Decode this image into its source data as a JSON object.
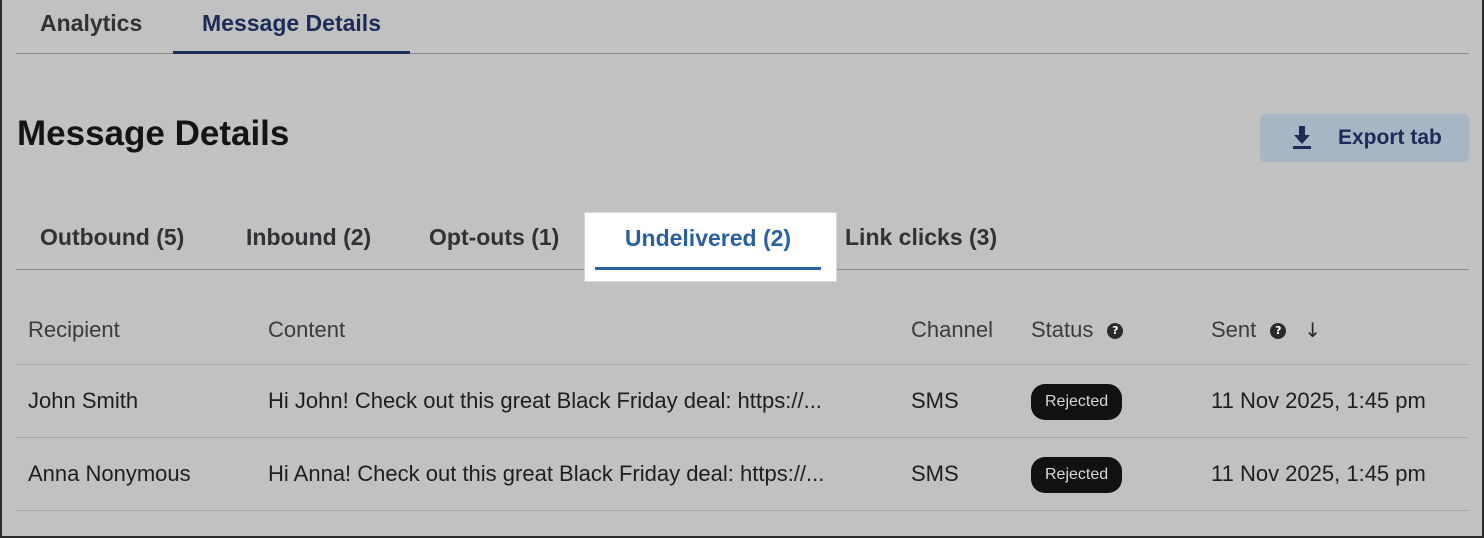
{
  "top_tabs": [
    "Analytics",
    "Message Details"
  ],
  "page_title": "Message Details",
  "export_button": {
    "label": "Export tab",
    "icon": "download-icon"
  },
  "sub_tabs": [
    "Outbound (5)",
    "Inbound (2)",
    "Opt-outs (1)",
    "Undelivered (2)",
    "Link clicks (3)"
  ],
  "active_sub_tab": "Undelivered (2)",
  "table": {
    "columns": [
      "Recipient",
      "Content",
      "Channel",
      "Status",
      "Sent"
    ],
    "help_glyph": "?",
    "sort_glyph": "↓",
    "rows": [
      {
        "recipient": "John Smith",
        "content": "Hi John! Check out this great Black Friday deal: https://...",
        "channel": "SMS",
        "status": "Rejected",
        "sent": "11 Nov 2025, 1:45 pm"
      },
      {
        "recipient": "Anna Nonymous",
        "content": "Hi Anna! Check out this great Black Friday deal: https://...",
        "channel": "SMS",
        "status": "Rejected",
        "sent": "11 Nov 2025, 1:45 pm"
      }
    ]
  },
  "colors": {
    "background": "#c1c1c1",
    "accent": "#2a5fa0",
    "navy": "#1c2c58",
    "badge": "#111111"
  }
}
